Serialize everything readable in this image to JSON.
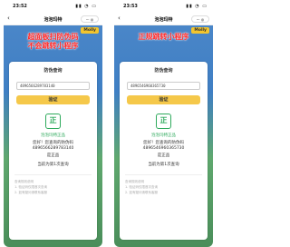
{
  "phones": [
    {
      "status": {
        "time": "23:52",
        "icons": "▮▮ ◔ ▭"
      },
      "nav": {
        "title": "泡泡玛特",
        "capsule": "··· ◎"
      },
      "banner": "超面板扫防伪码\n不会跳转小程序",
      "brand": "Molly",
      "card": {
        "title": "防伪查询",
        "code": "4896566289783140",
        "button": "验证",
        "icon": "正",
        "line1": "泡泡玛特正品",
        "line2": "您好！您查询的防伪码",
        "line3": "4896566289783140",
        "line4": "是正品",
        "count": "当前为第1次查询",
        "notes": [
          "查询规则说明",
          "1. 验证码仅限首次查询",
          "2. 如有疑问请联系客服"
        ]
      }
    },
    {
      "status": {
        "time": "23:53",
        "icons": "▮▮ ◔ ▭"
      },
      "nav": {
        "title": "泡泡玛特",
        "capsule": "··· ◎"
      },
      "banner": "正规跳转小程序",
      "brand": "Molly",
      "card": {
        "title": "防伪查询",
        "code": "4896546960365730",
        "button": "验证",
        "icon": "正",
        "line1": "泡泡玛特正品",
        "line2": "您好！您查询的防伪码",
        "line3": "4896546960365730",
        "line4": "是正品",
        "count": "当前为第1次查询",
        "notes": [
          "查询规则说明",
          "1. 验证码仅限首次查询",
          "2. 如有疑问请联系客服"
        ]
      }
    }
  ]
}
